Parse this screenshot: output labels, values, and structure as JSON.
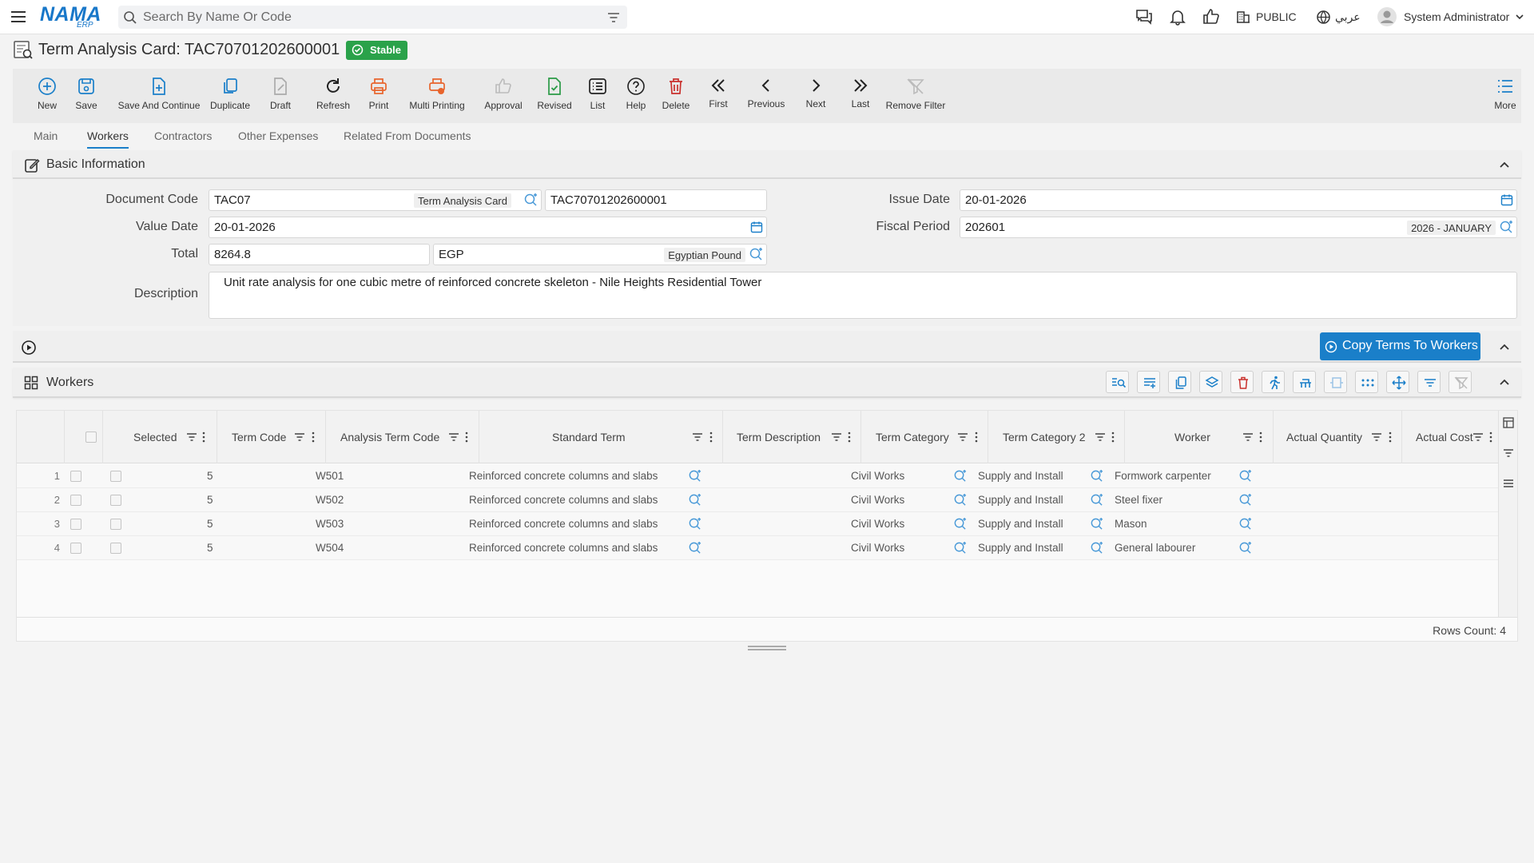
{
  "topbar": {
    "logo": "NAMA",
    "logo_sub": "ERP",
    "search_placeholder": "Search By Name Or Code",
    "company": "PUBLIC",
    "language": "عربي",
    "user": "System Administrator"
  },
  "page": {
    "title": "Term Analysis Card: TAC70701202600001",
    "status": "Stable"
  },
  "toolbar": {
    "new": "New",
    "save": "Save",
    "save_continue": "Save And Continue",
    "duplicate": "Duplicate",
    "draft": "Draft",
    "refresh": "Refresh",
    "print": "Print",
    "multi_printing": "Multi Printing",
    "approval": "Approval",
    "revised": "Revised",
    "list": "List",
    "help": "Help",
    "delete": "Delete",
    "first": "First",
    "previous": "Previous",
    "next": "Next",
    "last": "Last",
    "remove_filter": "Remove Filter",
    "more": "More"
  },
  "tabs": [
    "Main",
    "Workers",
    "Contractors",
    "Other Expenses",
    "Related From Documents"
  ],
  "basic_info": {
    "title": "Basic Information",
    "document_code_label": "Document Code",
    "document_code": "TAC07",
    "document_type": "Term Analysis Card",
    "document_number": "TAC70701202600001",
    "issue_date_label": "Issue Date",
    "issue_date": "20-01-2026",
    "value_date_label": "Value Date",
    "value_date": "20-01-2026",
    "fiscal_period_label": "Fiscal Period",
    "fiscal_period": "202601",
    "fiscal_period_name": "2026 - JANUARY",
    "total_label": "Total",
    "total": "8264.8",
    "currency_code": "EGP",
    "currency_name": "Egyptian Pound",
    "description_label": "Description",
    "description": "Unit rate analysis for one cubic metre of reinforced concrete skeleton - Nile Heights Residential Tower"
  },
  "actions": {
    "copy_terms": "Copy Terms To Workers"
  },
  "workers": {
    "title": "Workers",
    "columns": [
      "Selected",
      "Term Code",
      "Analysis Term Code",
      "Standard Term",
      "Term Description",
      "Term Category",
      "Term Category 2",
      "Worker",
      "Actual Quantity",
      "Actual Cost"
    ],
    "rows": [
      {
        "num": "1",
        "term_code": "5",
        "analysis_code": "W501",
        "standard_term": "Reinforced concrete columns and slabs",
        "description": "",
        "category": "Civil Works",
        "category2": "Supply and Install",
        "worker": "Formwork carpenter",
        "qty": "",
        "cost": ""
      },
      {
        "num": "2",
        "term_code": "5",
        "analysis_code": "W502",
        "standard_term": "Reinforced concrete columns and slabs",
        "description": "",
        "category": "Civil Works",
        "category2": "Supply and Install",
        "worker": "Steel fixer",
        "qty": "",
        "cost": ""
      },
      {
        "num": "3",
        "term_code": "5",
        "analysis_code": "W503",
        "standard_term": "Reinforced concrete columns and slabs",
        "description": "",
        "category": "Civil Works",
        "category2": "Supply and Install",
        "worker": "Mason",
        "qty": "",
        "cost": ""
      },
      {
        "num": "4",
        "term_code": "5",
        "analysis_code": "W504",
        "standard_term": "Reinforced concrete columns and slabs",
        "description": "",
        "category": "Civil Works",
        "category2": "Supply and Install",
        "worker": "General labourer",
        "qty": "",
        "cost": ""
      }
    ],
    "rows_count": "Rows Count: 4"
  }
}
